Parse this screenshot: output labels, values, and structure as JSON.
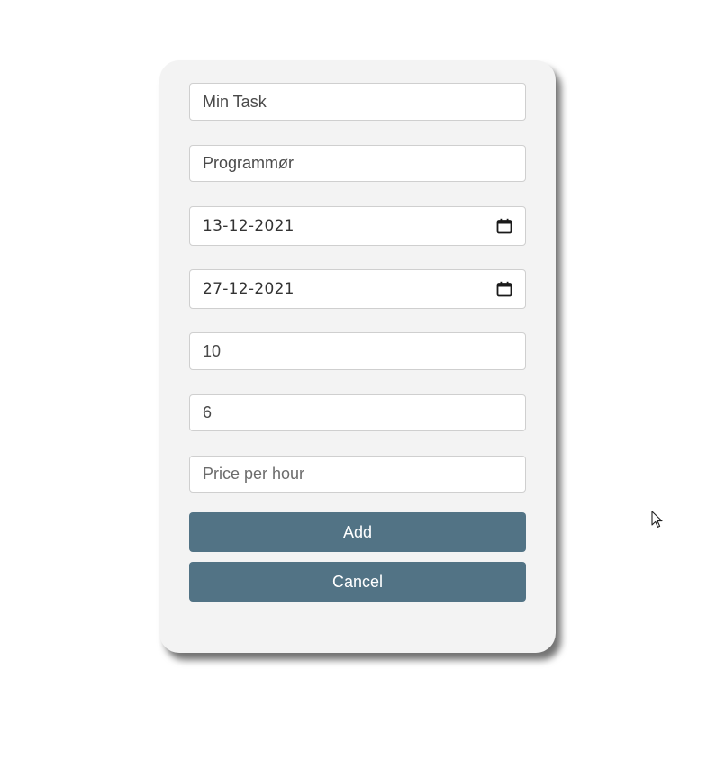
{
  "form": {
    "task_name": {
      "value": "Min Task"
    },
    "role": {
      "value": "Programmør"
    },
    "start_date": {
      "value": "13-12-2021",
      "icon": "calendar-icon"
    },
    "end_date": {
      "value": "27-12-2021",
      "icon": "calendar-icon"
    },
    "field_5": {
      "value": "10"
    },
    "field_6": {
      "value": "6"
    },
    "price_per_hour": {
      "value": "",
      "placeholder": "Price per hour"
    }
  },
  "buttons": {
    "add_label": "Add",
    "cancel_label": "Cancel"
  },
  "colors": {
    "button_bg": "#527385",
    "card_bg": "#f3f3f3"
  }
}
